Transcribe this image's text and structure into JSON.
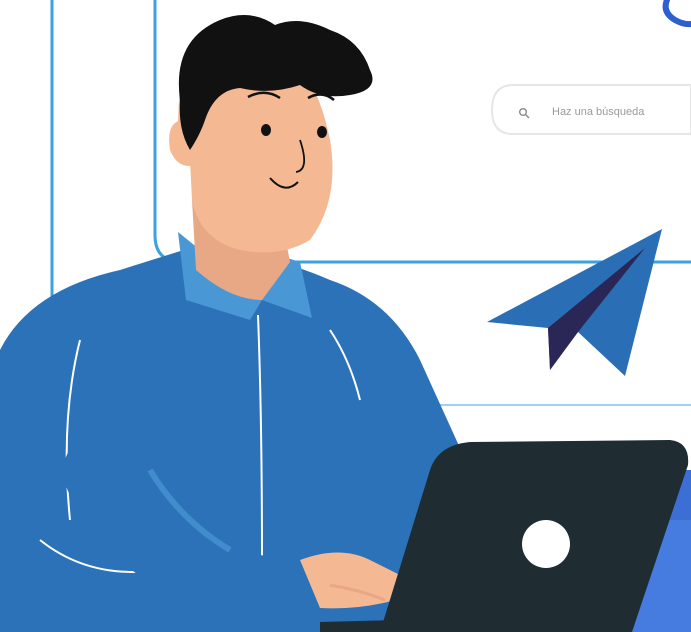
{
  "search": {
    "placeholder": "Haz una búsqueda",
    "icon": "search-icon"
  },
  "colors": {
    "panel_border": "#3aa3dd",
    "shirt": "#2c72b8",
    "shirt_light": "#4a97d5",
    "skin": "#f4b892",
    "hair": "#111111",
    "laptop": "#1f2d33",
    "plane": "#2a6fb6",
    "plane_dark": "#2a2656",
    "desk_blue": "#3b6fd6"
  }
}
